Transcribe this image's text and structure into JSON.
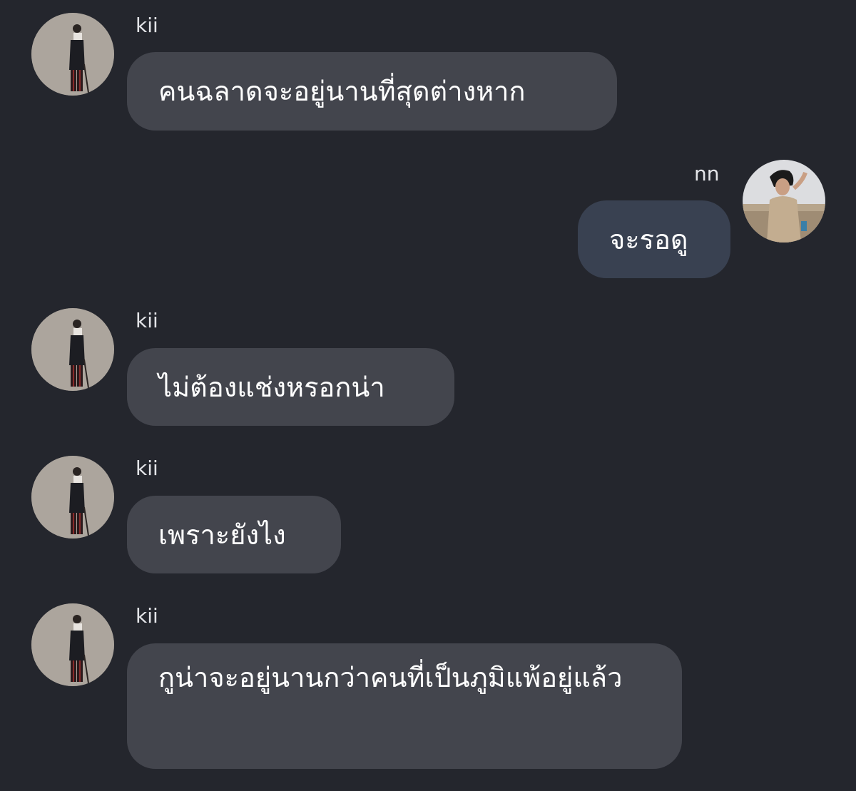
{
  "colors": {
    "background": "#24262d",
    "incoming_bubble": "#43454d",
    "outgoing_bubble": "#394151",
    "name_text": "#e3e4e8",
    "message_text": "#ffffff"
  },
  "messages": [
    {
      "sender": "kii",
      "direction": "incoming",
      "avatar_icon": "person-standing-avatar-icon",
      "text": "คนฉลาดจะอยู่นานที่สุดต่างหาก"
    },
    {
      "sender": "nn",
      "direction": "outgoing",
      "avatar_icon": "person-outdoor-avatar-icon",
      "text": "จะรอดู"
    },
    {
      "sender": "kii",
      "direction": "incoming",
      "avatar_icon": "person-standing-avatar-icon",
      "text": "ไม่ต้องแช่งหรอกน่า"
    },
    {
      "sender": "kii",
      "direction": "incoming",
      "avatar_icon": "person-standing-avatar-icon",
      "text": "เพราะยังไง"
    },
    {
      "sender": "kii",
      "direction": "incoming",
      "avatar_icon": "person-standing-avatar-icon",
      "text": "กูน่าจะอยู่นานกว่าคนที่เป็นภูมิแพ้อยู่แล้ว"
    }
  ]
}
